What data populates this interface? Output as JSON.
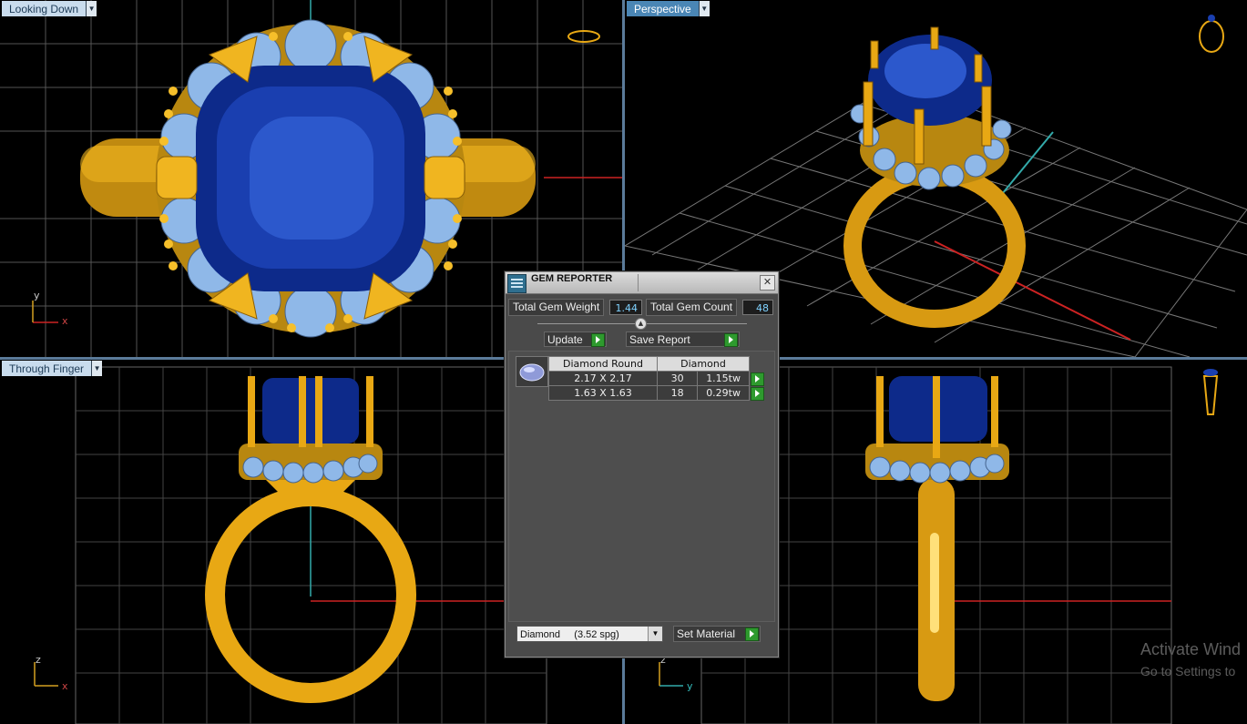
{
  "viewports": {
    "top_left": {
      "label": "Looking Down",
      "axis_h": "x",
      "axis_v": "y"
    },
    "top_right": {
      "label": "Perspective"
    },
    "bottom_left": {
      "label": "Through Finger",
      "axis_h": "x",
      "axis_v": "z"
    },
    "bottom_right": {
      "axis_h": "y",
      "axis_v": "z"
    }
  },
  "dialog": {
    "title": "GEM REPORTER",
    "close_glyph": "✕",
    "total_weight_label": "Total Gem Weight",
    "total_weight_value": "1.44",
    "total_count_label": "Total Gem Count",
    "total_count_value": "48",
    "update_label": "Update",
    "save_report_label": "Save Report",
    "table": {
      "headers": [
        "Diamond Round",
        "Diamond"
      ],
      "rows": [
        {
          "size": "2.17 X 2.17",
          "count": "30",
          "weight": "1.15tw"
        },
        {
          "size": "1.63 X 1.63",
          "count": "18",
          "weight": "0.29tw"
        }
      ]
    },
    "material_select": "Diamond     (3.52 spg)",
    "set_material_label": "Set Material"
  },
  "watermark": {
    "line1": "Activate Wind",
    "line2": "Go to Settings to"
  },
  "colors": {
    "gold": "#e8a814",
    "sapphire": "#1a3fb0",
    "diamond": "#8fb8e8",
    "grid": "#6a6a6a",
    "viewport_label": "#4a86b5",
    "go_button": "#2e9a2e"
  }
}
